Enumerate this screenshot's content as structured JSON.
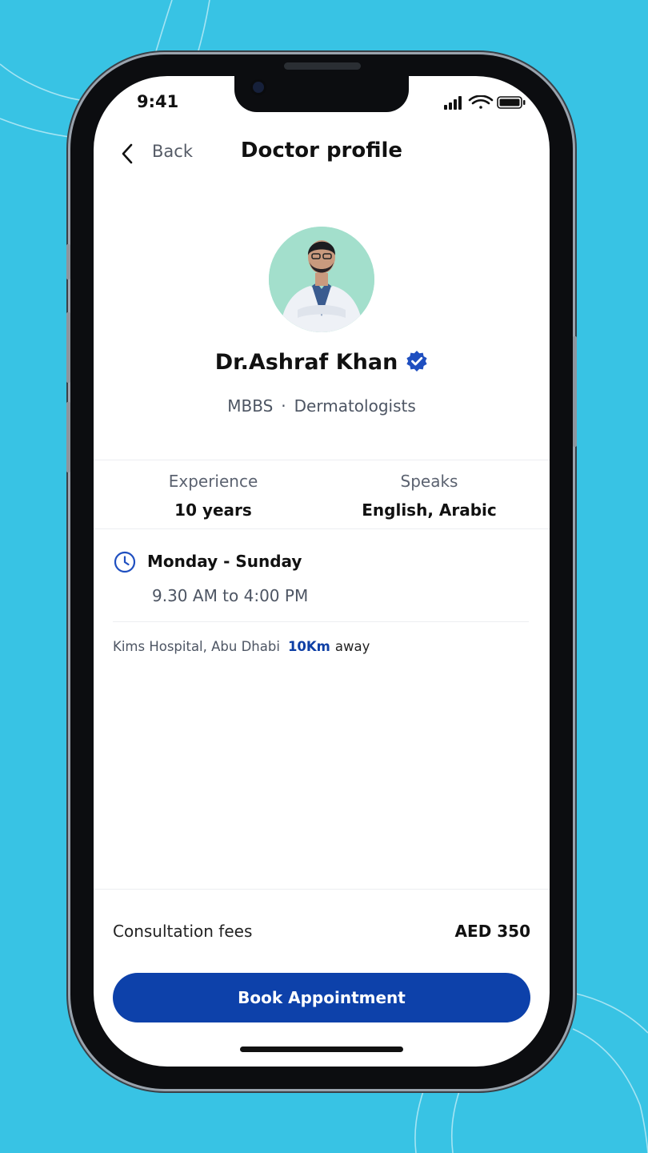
{
  "status_bar": {
    "time": "9:41"
  },
  "nav": {
    "back_label": "Back",
    "title": "Doctor profile"
  },
  "doctor": {
    "name": "Dr.Ashraf Khan",
    "degree": "MBBS",
    "separator": "·",
    "specialty": "Dermatologists"
  },
  "stats": [
    {
      "label": "Experience",
      "value": "10 years"
    },
    {
      "label": "Speaks",
      "value": "English, Arabic"
    }
  ],
  "schedule": {
    "days": "Monday - Sunday",
    "hours": "9.30 AM to 4:00 PM"
  },
  "location": {
    "hospital": "Kims Hospital, Abu Dhabi",
    "distance": "10Km",
    "suffix": "away"
  },
  "fees": {
    "label": "Consultation fees",
    "value": "AED 350"
  },
  "cta": {
    "label": "Book Appointment"
  },
  "colors": {
    "background": "#38c3e4",
    "accent": "#0d41aa",
    "verified": "#1f4fc0"
  },
  "icons": [
    "chevron-left-icon",
    "verified-badge-icon",
    "clock-icon",
    "signal-icon",
    "wifi-icon",
    "battery-icon"
  ]
}
